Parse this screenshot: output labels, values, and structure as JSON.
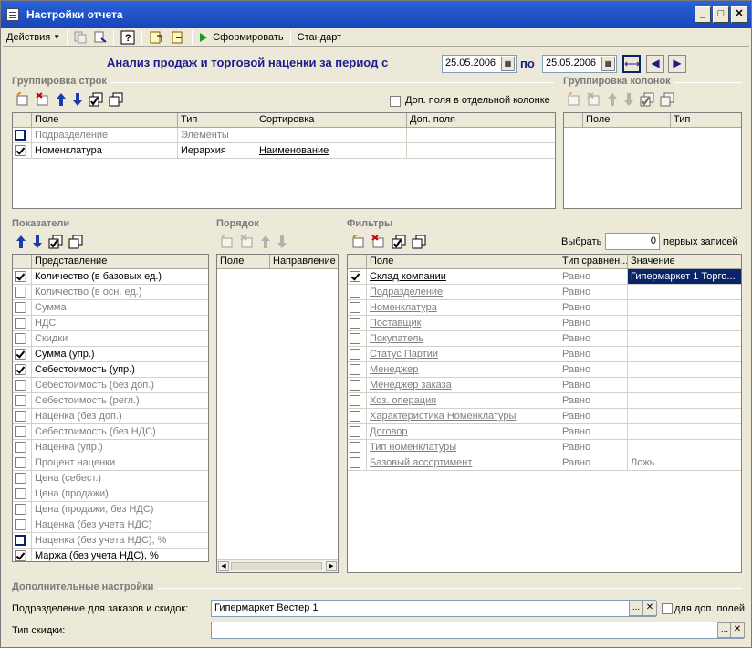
{
  "window": {
    "title": "Настройки отчета"
  },
  "toolbar": {
    "actions_label": "Действия",
    "generate_label": "Сформировать",
    "standard_label": "Стандарт"
  },
  "header": {
    "title": "Анализ продаж и торговой наценки  за период с",
    "date_from": "25.05.2006",
    "to_label": "по",
    "date_to": "25.05.2006"
  },
  "row_grouping": {
    "title": "Группировка строк",
    "extra_fields_label": "Доп. поля в отдельной колонке",
    "columns": [
      "Поле",
      "Тип",
      "Сортировка",
      "Доп. поля"
    ],
    "rows": [
      {
        "field": "Подразделение",
        "type": "Элементы",
        "sort": "",
        "extra": "",
        "checked": false
      },
      {
        "field": "Номенклатура",
        "type": "Иерархия",
        "sort": "Наименование",
        "extra": "",
        "checked": true
      }
    ]
  },
  "col_grouping": {
    "title": "Группировка колонок",
    "columns": [
      "Поле",
      "Тип"
    ]
  },
  "indicators": {
    "title": "Показатели",
    "column": "Представление",
    "rows": [
      {
        "label": "Количество (в базовых ед.)",
        "checked": true
      },
      {
        "label": "Количество (в осн. ед.)",
        "checked": false
      },
      {
        "label": "Сумма",
        "checked": false
      },
      {
        "label": "НДС",
        "checked": false
      },
      {
        "label": "Скидки",
        "checked": false
      },
      {
        "label": "Сумма (упр.)",
        "checked": true
      },
      {
        "label": "Себестоимость (упр.)",
        "checked": true
      },
      {
        "label": "Себестоимость (без доп.)",
        "checked": false
      },
      {
        "label": "Себестоимость (регл.)",
        "checked": false
      },
      {
        "label": "Наценка (без доп.)",
        "checked": false
      },
      {
        "label": "Себестоимость (без НДС)",
        "checked": false
      },
      {
        "label": "Наценка (упр.)",
        "checked": false
      },
      {
        "label": "Процент наценки",
        "checked": false
      },
      {
        "label": "Цена (себест.)",
        "checked": false
      },
      {
        "label": "Цена (продажи)",
        "checked": false
      },
      {
        "label": "Цена (продажи, без НДС)",
        "checked": false
      },
      {
        "label": "Наценка (без учета НДС)",
        "checked": false
      },
      {
        "label": "Наценка (без учета НДС), %",
        "checked": false
      },
      {
        "label": "Маржа (без учета НДС), %",
        "checked": true
      }
    ]
  },
  "order": {
    "title": "Порядок",
    "columns": [
      "Поле",
      "Направление"
    ]
  },
  "filters": {
    "title": "Фильтры",
    "select_label": "Выбрать",
    "select_value": "0",
    "first_records_label": "первых записей",
    "columns": [
      "Поле",
      "Тип сравнен...",
      "Значение"
    ],
    "rows": [
      {
        "field": "Склад компании",
        "cmp": "Равно",
        "value": "Гипермаркет 1 Торго...",
        "checked": true
      },
      {
        "field": "Подразделение",
        "cmp": "Равно",
        "value": "",
        "checked": false
      },
      {
        "field": "Номенклатура",
        "cmp": "Равно",
        "value": "",
        "checked": false
      },
      {
        "field": "Поставщик",
        "cmp": "Равно",
        "value": "",
        "checked": false
      },
      {
        "field": "Покупатель",
        "cmp": "Равно",
        "value": "",
        "checked": false
      },
      {
        "field": "Статус Партии",
        "cmp": "Равно",
        "value": "",
        "checked": false
      },
      {
        "field": "Менеджер",
        "cmp": "Равно",
        "value": "",
        "checked": false
      },
      {
        "field": "Менеджер заказа",
        "cmp": "Равно",
        "value": "",
        "checked": false
      },
      {
        "field": "Хоз. операция",
        "cmp": "Равно",
        "value": "",
        "checked": false
      },
      {
        "field": "Характеристика Номенклатуры",
        "cmp": "Равно",
        "value": "",
        "checked": false
      },
      {
        "field": "Договор",
        "cmp": "Равно",
        "value": "",
        "checked": false
      },
      {
        "field": "Тип номенклатуры",
        "cmp": "Равно",
        "value": "",
        "checked": false
      },
      {
        "field": "Базовый ассортимент",
        "cmp": "Равно",
        "value": "Ложь",
        "checked": false
      }
    ]
  },
  "extra": {
    "title": "Дополнительные настройки",
    "division_label": "Подразделение для заказов и скидок:",
    "division_value": "Гипермаркет Вестер 1",
    "for_extra_fields_label": "для доп. полей",
    "discount_type_label": "Тип скидки:",
    "discount_type_value": ""
  }
}
